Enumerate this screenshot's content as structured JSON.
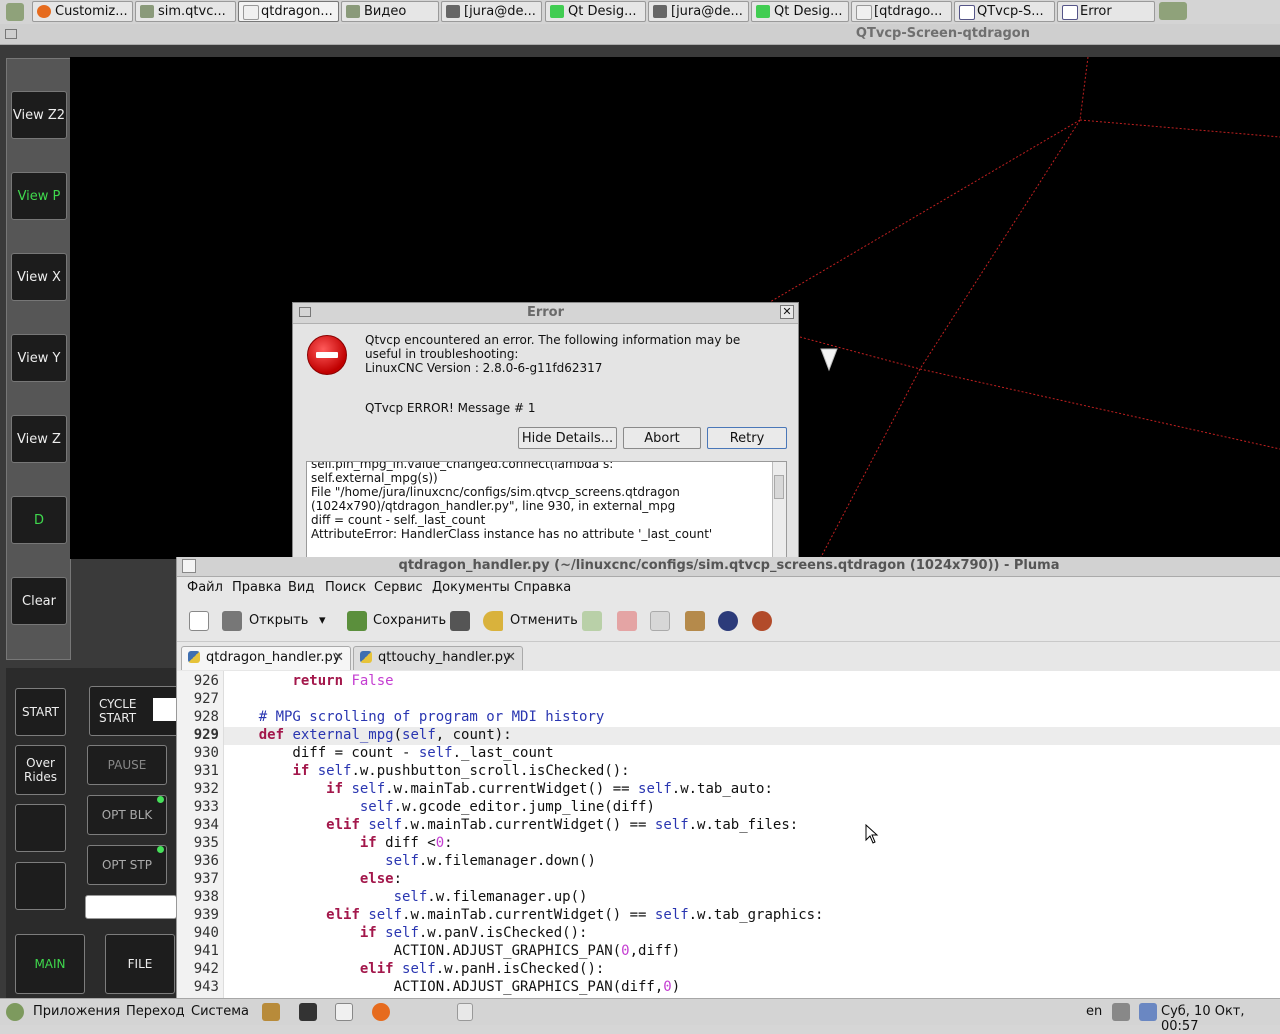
{
  "taskbar": {
    "items": [
      {
        "label": "Customiz..."
      },
      {
        "label": "sim.qtvc..."
      },
      {
        "label": "qtdragon..."
      },
      {
        "label": "Видео"
      },
      {
        "label": "[jura@de..."
      },
      {
        "label": "Qt Desig..."
      },
      {
        "label": "[jura@de..."
      },
      {
        "label": "Qt Desig..."
      },
      {
        "label": "[qtdrago..."
      },
      {
        "label": "QTvcp-S..."
      },
      {
        "label": "Error"
      }
    ]
  },
  "qtvcp": {
    "title": "QTvcp-Screen-qtdragon",
    "view_buttons": [
      "View Z2",
      "View P",
      "View X",
      "View Y",
      "View Z",
      "D",
      "Clear"
    ],
    "control_buttons": {
      "start": "START",
      "cycle_start": "CYCLE START",
      "overrides": "Over Rides",
      "pause": "PAUSE",
      "opt_blk": "OPT BLK",
      "opt_stp": "OPT STP",
      "main": "MAIN",
      "file": "FILE"
    }
  },
  "dialog": {
    "title": "Error",
    "message_line1": "Qtvcp encountered an error.  The following information may be",
    "message_line2": "useful in troubleshooting:",
    "message_line3": "LinuxCNC Version  : 2.8.0-6-g11fd62317",
    "message_line4": "QTvcp ERROR! Message # 1",
    "buttons": {
      "details": "Hide Details...",
      "abort": "Abort",
      "retry": "Retry"
    },
    "details": [
      "    self.pin_mpg_in.value_changed.connect(lambda s:",
      "self.external_mpg(s))",
      "  File \"/home/jura/linuxcnc/configs/sim.qtvcp_screens.qtdragon",
      "(1024x790)/qtdragon_handler.py\", line 930, in external_mpg",
      "    diff = count - self._last_count",
      "AttributeError: HandlerClass instance has no attribute '_last_count'"
    ]
  },
  "pluma": {
    "title": "qtdragon_handler.py (~/linuxcnc/configs/sim.qtvcp_screens.qtdragon (1024x790)) - Pluma",
    "menu": [
      "Файл",
      "Правка",
      "Вид",
      "Поиск",
      "Сервис",
      "Документы",
      "Справка"
    ],
    "toolbar": {
      "open": "Открыть",
      "save": "Сохранить",
      "undo": "Отменить"
    },
    "tabs": [
      "qtdragon_handler.py",
      "qttouchy_handler.py"
    ],
    "line_numbers": [
      "926",
      "927",
      "928",
      "929",
      "930",
      "931",
      "932",
      "933",
      "934",
      "935",
      "936",
      "937",
      "938",
      "939",
      "940",
      "941",
      "942",
      "943"
    ]
  },
  "bottombar": {
    "menu": [
      "Приложения",
      "Переход",
      "Система"
    ],
    "lang": "en",
    "clock": "Суб, 10 Окт, 00:57"
  },
  "colors": {
    "viewport_bg": "#000000",
    "led_green": "#46e05a",
    "code_keyword": "#a3174b",
    "code_builtin": "#2a36b1",
    "code_number": "#c43dd1"
  }
}
